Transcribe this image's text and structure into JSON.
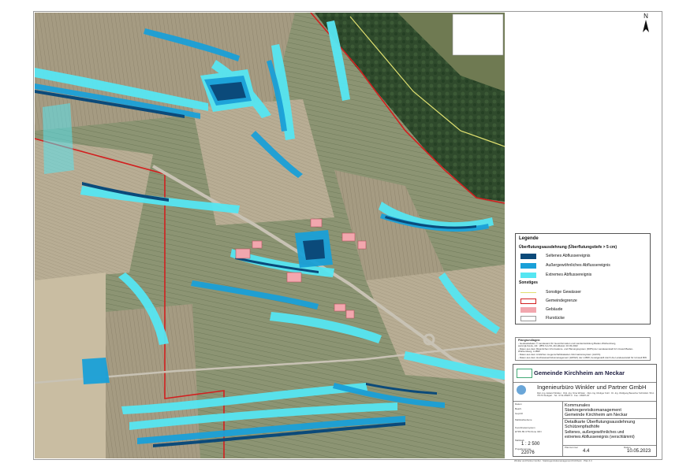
{
  "map": {
    "north_label": "N",
    "colors": {
      "selten": "#0b4a7a",
      "aussergewoehnlich": "#1aa0d8",
      "extrem": "#56e6f2",
      "gemeindegrenze": "#d21f1f",
      "gebaeude": "#f2a7ae",
      "gewaesser": "#e0e070",
      "flur": "#d8d8d8"
    }
  },
  "legend": {
    "title": "Legende",
    "flood_heading": "Überflutungsausdehnung (Überflutungstiefe > 5 cm)",
    "flood_items": [
      {
        "label": "Seltenes Abflussereignis",
        "color": "#0b4a7a"
      },
      {
        "label": "Außergewöhnliches Abflussereignis",
        "color": "#1aa0d8"
      },
      {
        "label": "Extremes Abflussereignis",
        "color": "#56e6f2"
      }
    ],
    "other_heading": "Sonstiges",
    "other_items": [
      {
        "label": "Sonstige Gewässer",
        "type": "line",
        "color": "#e0e070"
      },
      {
        "label": "Gemeindegrenze",
        "type": "outline",
        "color": "#d21f1f"
      },
      {
        "label": "Gebäude",
        "type": "fill",
        "color": "#f2a7ae"
      },
      {
        "label": "Flurstücke",
        "type": "outline",
        "color": "#9a9a9a"
      }
    ]
  },
  "notes": {
    "title": "Plangrundlagen:",
    "lines": [
      "- Geobasisdaten © Landesamt für Geoinformation und Landentwicklung Baden-Württemberg,",
      "  www.lgl-bw.de, AZ.: 2851.9-1/19, Abrufdatum 16.03.2022",
      "- Daten aus dem Räumlichen Informations- und Planungssystem (RIPS) der Landesanstalt für Umwelt Baden-Württemberg, LUBW",
      "- Daten aus dem Amtlichen Liegenschaftskataster-Informationssystem (ALKIS)",
      "- Daten aus dem Hochwasserrisikomanagement (HWGK) der LUBW, bereitgestellt durch die Landesanstalt für Umwelt BW"
    ]
  },
  "titleblock": {
    "client": "Gemeinde Kirchheim am Neckar",
    "firm": "Ingenieurbüro Winkler und Partner GmbH",
    "firm_address": "Dipl.-Ing. Eckard Winkler · Dipl.-Ing. Nina Winkler · Dipl.-Ing. Rüdiger Kohl · Dr.-Ing. Wolfgang Bauscher  Schloßstr. 59 A · 70176 Stuttgart · Tel.: 0711-66987-0 · Fax: -66987-20",
    "left_cells": [
      "Datum",
      "Bearb.",
      "Geprüft",
      "Maßstabsebene",
      "Koordinatensystem",
      "ETRS 89 UTM Zone 32N"
    ],
    "scale_label": "Maßstab",
    "scale": "1 : 2 500",
    "project_no_label": "Projektnummer",
    "project_no": "22076",
    "project_lines": [
      "Kommunales",
      "Starkregenrisikomanagement",
      "Gemeinde Kirchheim am Neckar"
    ],
    "map_title_lines": [
      "Detailkarte Überflutungsausdehnung",
      "Schützenpfadhöfe"
    ],
    "event_lines": [
      "Seltenes, außergewöhnliches und",
      "extremes Abflussereignis (verschlämmt)"
    ],
    "plan_no_label": "Plannummer",
    "plan_no": "4.4",
    "date_label": "Datum",
    "date": "10.05.2023"
  },
  "footer": "Winkler und Partner GmbH  ·  Starkregenrisikomanagement Kirchheim  ·  Plan 4.4"
}
